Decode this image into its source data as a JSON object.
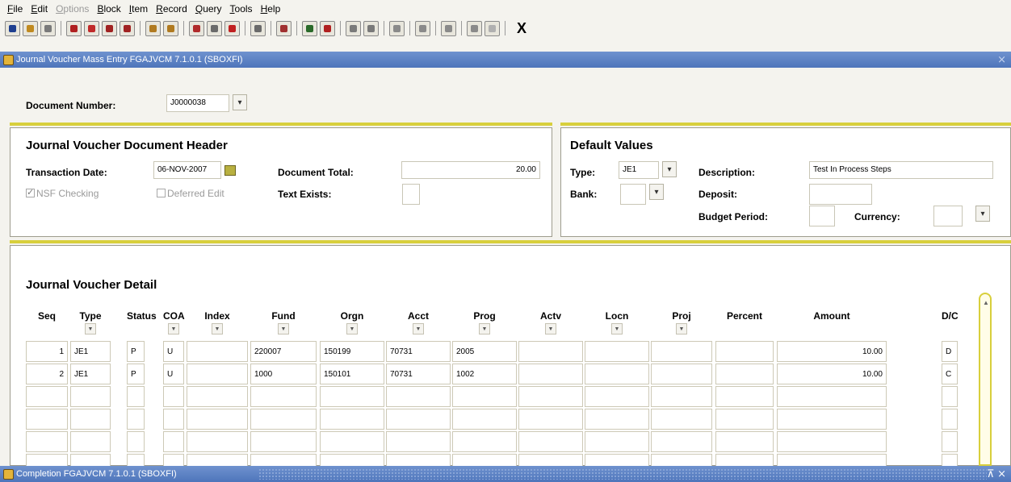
{
  "menu": [
    {
      "label": "File",
      "u": "F",
      "rest": "ile",
      "enabled": true
    },
    {
      "label": "Edit",
      "u": "E",
      "rest": "dit",
      "enabled": true
    },
    {
      "label": "Options",
      "u": "O",
      "rest": "ptions",
      "enabled": false
    },
    {
      "label": "Block",
      "u": "B",
      "rest": "lock",
      "enabled": true
    },
    {
      "label": "Item",
      "u": "I",
      "rest": "tem",
      "enabled": true
    },
    {
      "label": "Record",
      "u": "R",
      "rest": "ecord",
      "enabled": true
    },
    {
      "label": "Query",
      "u": "Q",
      "rest": "uery",
      "enabled": true
    },
    {
      "label": "Tools",
      "u": "T",
      "rest": "ools",
      "enabled": true
    },
    {
      "label": "Help",
      "u": "H",
      "rest": "elp",
      "enabled": true
    }
  ],
  "toolbar": {
    "icons": [
      {
        "name": "save-icon",
        "color": "#1f3f8f"
      },
      {
        "name": "rollback-icon",
        "color": "#c08a20"
      },
      {
        "name": "print-icon",
        "color": "#7a7a7a"
      },
      {
        "sep": true
      },
      {
        "name": "select-icon",
        "color": "#b02020"
      },
      {
        "name": "exit-icon",
        "color": "#c02a2a"
      },
      {
        "name": "previous-block-icon",
        "color": "#a02222"
      },
      {
        "name": "next-block-icon",
        "color": "#a02222"
      },
      {
        "sep": true
      },
      {
        "name": "previous-record-icon",
        "color": "#b07a20"
      },
      {
        "name": "next-record-icon",
        "color": "#b07a20"
      },
      {
        "sep": true
      },
      {
        "name": "insert-record-icon",
        "color": "#b02a2a"
      },
      {
        "name": "remove-record-icon",
        "color": "#6a6a6a"
      },
      {
        "name": "delete-record-icon",
        "color": "#c02020"
      },
      {
        "sep": true
      },
      {
        "name": "copy-icon",
        "color": "#6a6a6a"
      },
      {
        "sep": true
      },
      {
        "name": "print-report-icon",
        "color": "#a03030"
      },
      {
        "sep": true
      },
      {
        "name": "enter-query-icon",
        "color": "#2a6a2a"
      },
      {
        "name": "execute-query-icon",
        "color": "#b02020"
      },
      {
        "sep": true
      },
      {
        "name": "cancel-query-icon",
        "color": "#7a7a7a"
      },
      {
        "name": "count-query-icon",
        "color": "#7a7a7a"
      },
      {
        "sep": true
      },
      {
        "name": "list-values-icon",
        "color": "#8a8a8a"
      },
      {
        "sep": true
      },
      {
        "name": "help-icon",
        "color": "#8a8a8a"
      },
      {
        "sep": true
      },
      {
        "name": "window-icon",
        "color": "#8a8a8a"
      },
      {
        "sep": true
      },
      {
        "name": "online-help-icon",
        "color": "#8a8a8a"
      },
      {
        "name": "lightbulb-icon",
        "color": "#b0b0b0"
      },
      {
        "sep": true
      }
    ],
    "exit_label": "X"
  },
  "window": {
    "title": "Journal Voucher Mass Entry FGAJVCM 7.1.0.1 (SBOXFI)",
    "bottom_title": "Completion FGAJVCM 7.1.0.1 (SBOXFI)"
  },
  "key_block": {
    "doc_number_label": "Document Number:",
    "doc_number_value": "J0000038"
  },
  "header": {
    "title": "Journal Voucher Document Header",
    "trans_date_label": "Transaction Date:",
    "trans_date_value": "06-NOV-2007",
    "doc_total_label": "Document Total:",
    "doc_total_value": "20.00",
    "nsf_label": "NSF Checking",
    "deferred_label": "Deferred Edit",
    "text_exists_label": "Text Exists:",
    "text_exists_value": ""
  },
  "defaults": {
    "title": "Default Values",
    "type_label": "Type:",
    "type_value": "JE1",
    "bank_label": "Bank:",
    "bank_value": "",
    "description_label": "Description:",
    "description_value": "Test In Process Steps",
    "deposit_label": "Deposit:",
    "deposit_value": "",
    "budget_period_label": "Budget Period:",
    "budget_period_value": "",
    "currency_label": "Currency:",
    "currency_value": ""
  },
  "detail": {
    "title": "Journal Voucher Detail",
    "columns": [
      {
        "label": "Seq",
        "dropdown": false
      },
      {
        "label": "Type",
        "dropdown": true
      },
      {
        "label": "Status",
        "dropdown": false
      },
      {
        "label": "COA",
        "dropdown": true
      },
      {
        "label": "Index",
        "dropdown": true
      },
      {
        "label": "Fund",
        "dropdown": true
      },
      {
        "label": "Orgn",
        "dropdown": true
      },
      {
        "label": "Acct",
        "dropdown": true
      },
      {
        "label": "Prog",
        "dropdown": true
      },
      {
        "label": "Actv",
        "dropdown": true
      },
      {
        "label": "Locn",
        "dropdown": true
      },
      {
        "label": "Proj",
        "dropdown": true
      },
      {
        "label": "Percent",
        "dropdown": false
      },
      {
        "label": "Amount",
        "dropdown": false
      },
      {
        "label": "D/C",
        "dropdown": false
      }
    ],
    "rows": [
      [
        "1",
        "JE1",
        "P",
        "U",
        "",
        "220007",
        "150199",
        "70731",
        "2005",
        "",
        "",
        "",
        "",
        "10.00",
        "D"
      ],
      [
        "2",
        "JE1",
        "P",
        "U",
        "",
        "1000",
        "150101",
        "70731",
        "1002",
        "",
        "",
        "",
        "",
        "10.00",
        "C"
      ],
      [
        "",
        "",
        "",
        "",
        "",
        "",
        "",
        "",
        "",
        "",
        "",
        "",
        "",
        "",
        ""
      ],
      [
        "",
        "",
        "",
        "",
        "",
        "",
        "",
        "",
        "",
        "",
        "",
        "",
        "",
        "",
        ""
      ],
      [
        "",
        "",
        "",
        "",
        "",
        "",
        "",
        "",
        "",
        "",
        "",
        "",
        "",
        "",
        ""
      ],
      [
        "",
        "",
        "",
        "",
        "",
        "",
        "",
        "",
        "",
        "",
        "",
        "",
        "",
        "",
        ""
      ]
    ]
  }
}
